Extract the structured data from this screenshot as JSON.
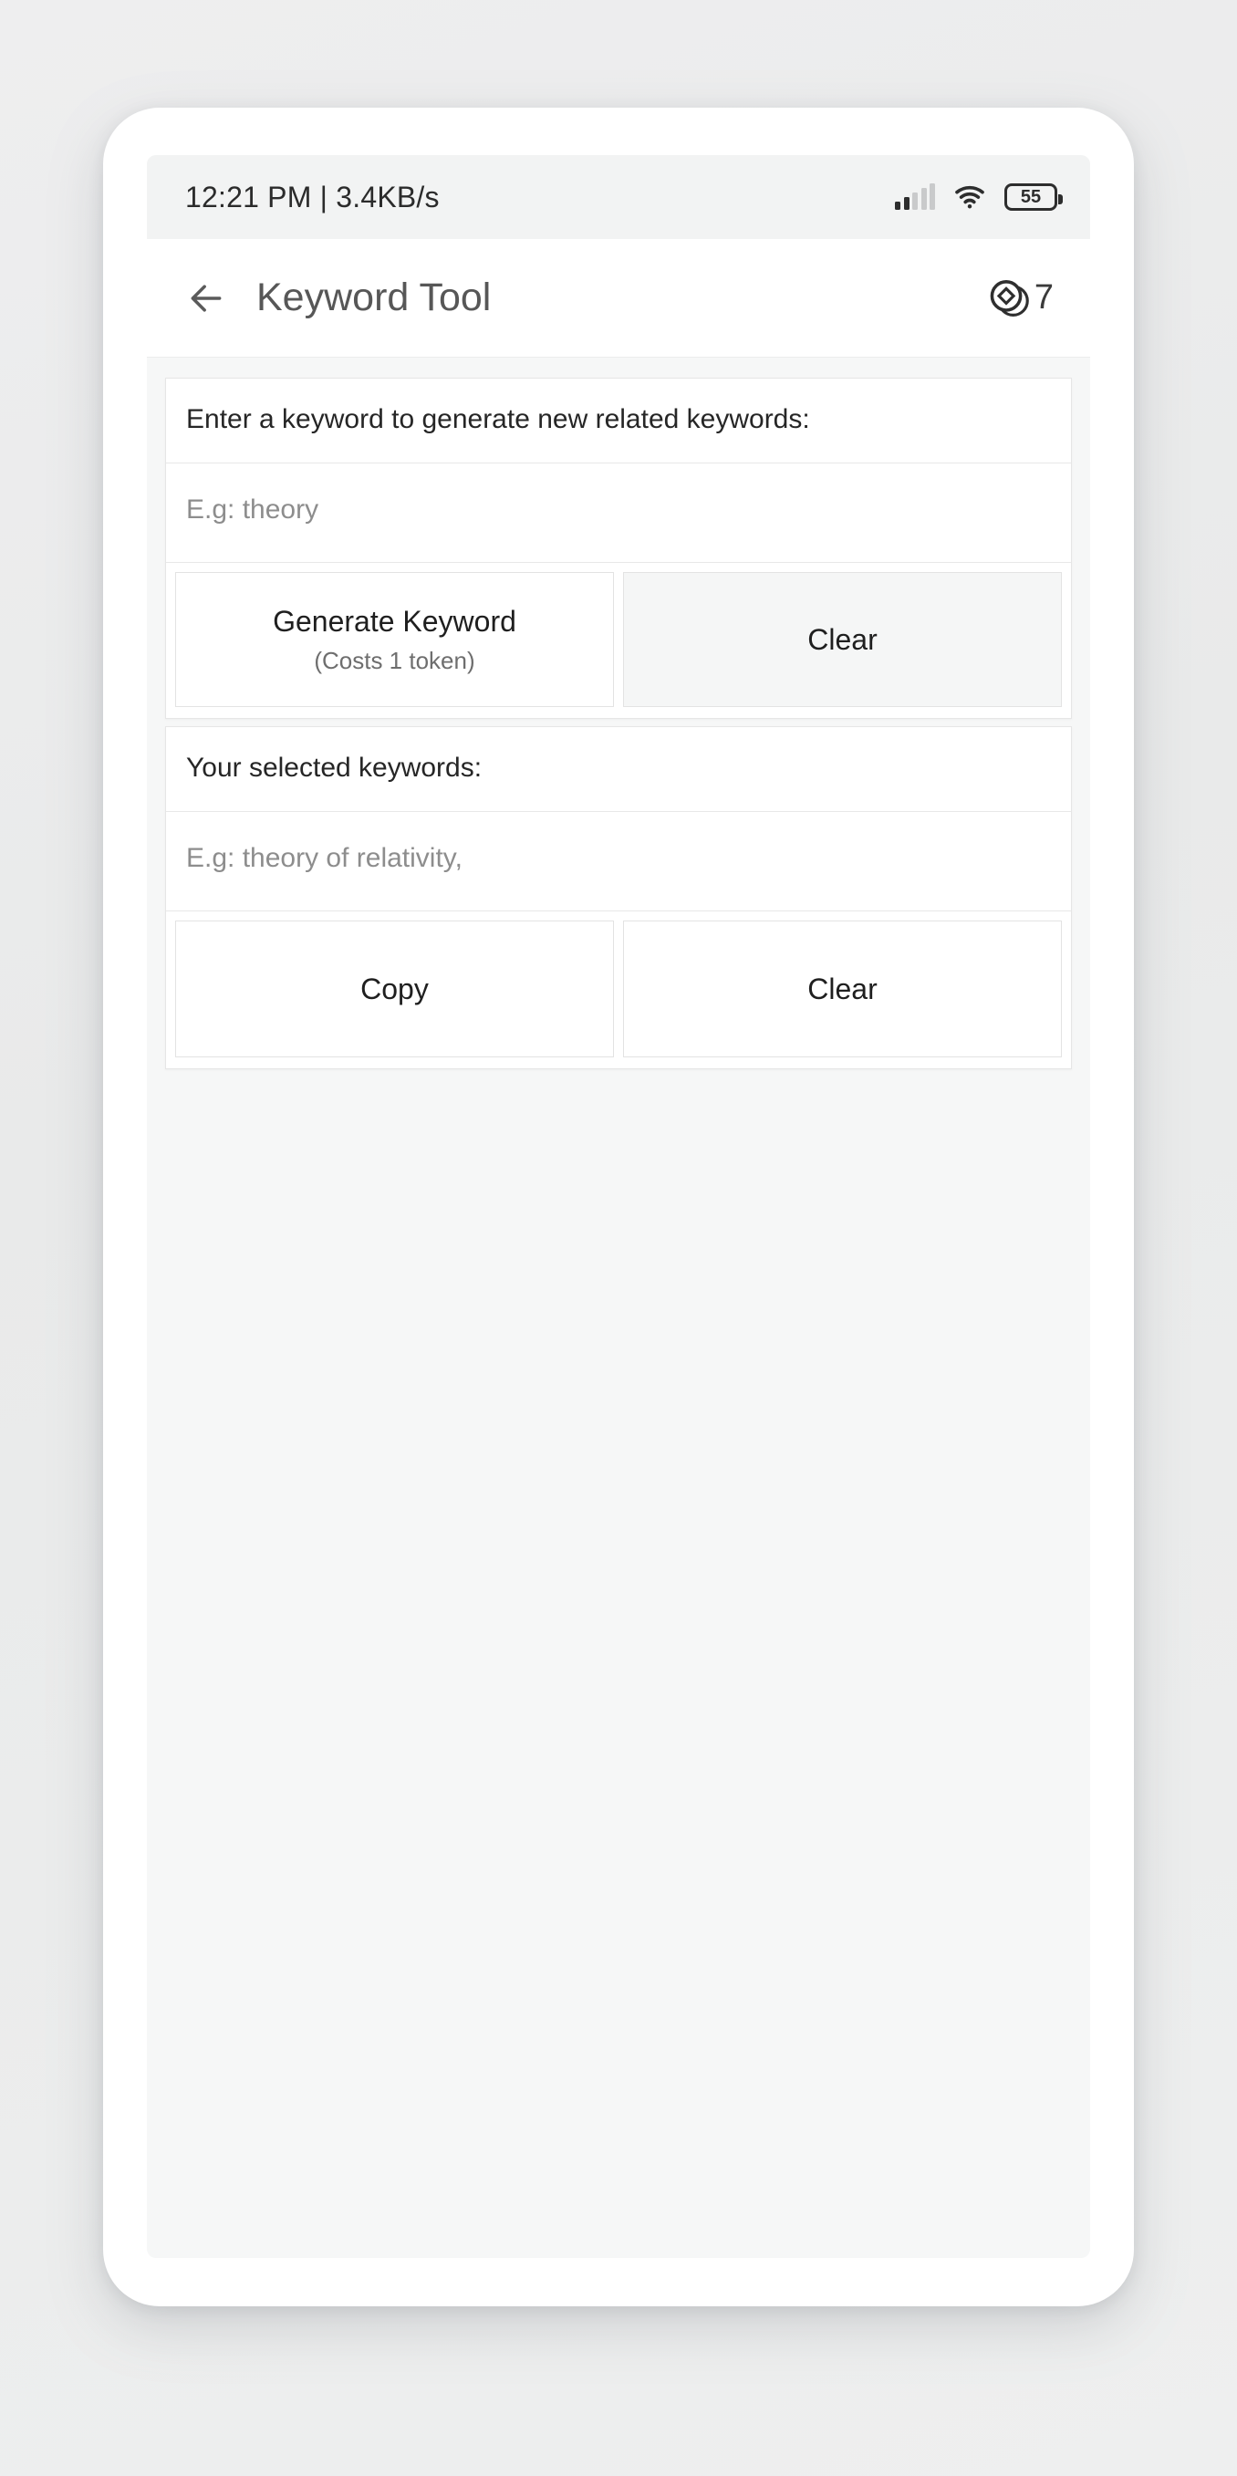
{
  "statusbar": {
    "time_and_network": "12:21 PM | 3.4KB/s",
    "signal_icon": "signal-bars-icon",
    "wifi_icon": "wifi-icon",
    "battery_level": "55",
    "battery_icon": "battery-icon"
  },
  "appbar": {
    "back_icon": "back-arrow-icon",
    "title": "Keyword Tool",
    "token_icon": "token-coin-icon",
    "token_count": "7"
  },
  "generate_section": {
    "label": "Enter a keyword to generate new related keywords:",
    "input_placeholder": "E.g: theory",
    "input_value": "",
    "primary_button": {
      "label": "Generate Keyword",
      "sublabel": "(Costs 1 token)"
    },
    "secondary_button": {
      "label": "Clear"
    }
  },
  "selected_section": {
    "label": "Your selected keywords:",
    "input_placeholder": "E.g: theory of relativity,",
    "input_value": "",
    "copy_button": {
      "label": "Copy"
    },
    "clear_button": {
      "label": "Clear"
    }
  },
  "colors": {
    "page_background": "#eceded",
    "screen_background": "#f6f7f7",
    "card_background": "#ffffff",
    "status_background": "#f2f3f3",
    "title_text": "#575757",
    "body_text": "#262626",
    "placeholder_text": "#8d8d8d",
    "tinted_button": "#f5f6f6"
  }
}
